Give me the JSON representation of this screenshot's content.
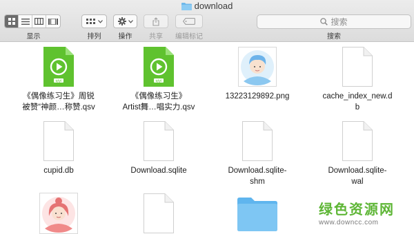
{
  "window": {
    "title": "download",
    "icon": "folder-icon"
  },
  "toolbar": {
    "view_label": "显示",
    "arrange_label": "排列",
    "action_label": "操作",
    "share_label": "共享",
    "tags_label": "编辑标记",
    "search_label": "搜索",
    "search_placeholder": "搜索",
    "view_modes": [
      "icon-view",
      "list-view",
      "column-view",
      "gallery-view"
    ],
    "active_view": "icon-view"
  },
  "files": [
    {
      "name": "《偶像练习生》周锐\n被赞“神颜…称赞.qsv",
      "icon": "qsv-video-icon"
    },
    {
      "name": "《偶像练习生》\nArtist舞…唱实力.qsv",
      "icon": "qsv-video-icon"
    },
    {
      "name": "13223129892.png",
      "icon": "avatar-boy-thumbnail"
    },
    {
      "name": "cache_index_new.d\nb",
      "icon": "document-icon"
    },
    {
      "name": "cupid.db",
      "icon": "document-icon"
    },
    {
      "name": "Download.sqlite",
      "icon": "document-icon"
    },
    {
      "name": "Download.sqlite-\nshm",
      "icon": "document-icon"
    },
    {
      "name": "Download.sqlite-\nwal",
      "icon": "document-icon"
    },
    {
      "name": "",
      "icon": "avatar-girl-thumbnail"
    },
    {
      "name": "",
      "icon": "document-icon"
    },
    {
      "name": "",
      "icon": "folder-icon"
    }
  ],
  "watermark": {
    "title": "绿色资源网",
    "url": "www.downcc.com"
  },
  "colors": {
    "qsv_green": "#5fc22f",
    "folder_blue": "#5fb5ee",
    "watermark_green": "#5eb636"
  }
}
